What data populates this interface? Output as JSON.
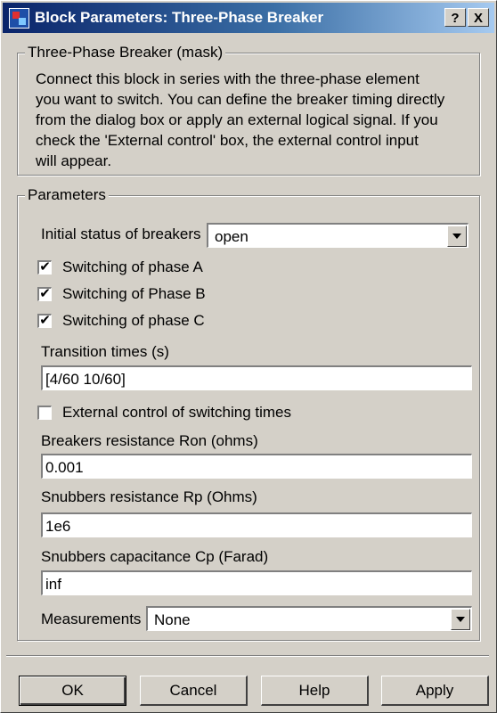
{
  "dialog": {
    "title": "Block Parameters: Three-Phase Breaker",
    "help_glyph": "?",
    "close_glyph": "X"
  },
  "mask": {
    "legend": "Three-Phase Breaker (mask)",
    "description_lines": [
      "Connect this block in series with the three-phase element",
      "you want to switch. You can define the breaker timing directly",
      "from the dialog box or apply an external logical signal. If you",
      "check  the 'External control' box, the external control input",
      "will appear."
    ]
  },
  "parameters": {
    "legend": "Parameters",
    "initial_status_label": "Initial status of breakers",
    "initial_status_value": "open",
    "phase_a_label": "Switching of phase A",
    "phase_a_checked": true,
    "phase_b_label": "Switching of Phase B",
    "phase_b_checked": true,
    "phase_c_label": "Switching of phase C",
    "phase_c_checked": true,
    "transition_times_label": "Transition times (s)",
    "transition_times_value": "[4/60  10/60]",
    "external_control_label": "External control of switching times",
    "external_control_checked": false,
    "ron_label": "Breakers resistance Ron (ohms)",
    "ron_value": "0.001",
    "rp_label": "Snubbers resistance Rp (Ohms)",
    "rp_value": "1e6",
    "cp_label": "Snubbers capacitance Cp (Farad)",
    "cp_value": "inf",
    "measurements_label": "Measurements",
    "measurements_value": "None"
  },
  "buttons": {
    "ok": "OK",
    "cancel": "Cancel",
    "help": "Help",
    "apply": "Apply"
  },
  "colors": {
    "title_gradient_start": "#0a246a",
    "title_gradient_end": "#a6caf0",
    "dialog_face": "#d4d0c8"
  }
}
